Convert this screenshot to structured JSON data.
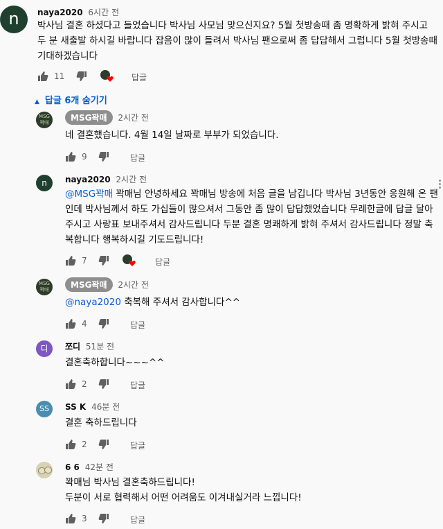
{
  "colors": {
    "link": "#065fd4",
    "meta": "#606060",
    "badge": "#8e8e8e",
    "heart": "#ff0000"
  },
  "icons": [
    "thumb-up-icon",
    "thumb-down-icon",
    "creator-heart-icon",
    "caret-up-icon",
    "more-vert-icon"
  ],
  "reply_label": "답글",
  "hide_replies": "답글 6개 숨기기",
  "comments": [
    {
      "author": "naya2020",
      "time": "6시간 전",
      "avatar": "n",
      "lines": [
        "박사님 결혼 하셨다고 들었습니다 박사님 사모님 맞으신지요?  5월 첫방송때 좀 명확하게 밝혀 주시고",
        "두 분 새출발 하시길 바랍니다 잡음이 많이 들려서 박사님 팬으로써 좀 답답해서 그럽니다 5월 첫방송때",
        "기대하겠습니다"
      ],
      "likes": "11",
      "hearted": true
    },
    {
      "author": "MSG꽉매",
      "time": "2시간 전",
      "avatar": "MSG 꽉매",
      "lines": [
        "네 결혼했습니다. 4월 14일 날짜로 부부가 되었습니다."
      ],
      "likes": "9",
      "hearted": false
    },
    {
      "author": "naya2020",
      "time": "2시간 전",
      "avatar": "n",
      "mention": "@MSG꽉매",
      "lines": [
        " 꽉매님 안녕하세요 꽉매님 방송에 처음 글을 남깁니다 박사님 3년동안 응원해 온 팬",
        "인데 박사님께서 하도 가십들이 많으셔서 그동안 좀 많이 답답했었습니다 무례한글에 답글 달아",
        "주시고 사랑표 보내주셔서 감사드립니다 두분 결혼 명쾌하게 밝혀 주셔서 감사드립니다 정말 축",
        "복합니다 행복하시길 기도드립니다!"
      ],
      "likes": "7",
      "hearted": true
    },
    {
      "author": "MSG꽉매",
      "time": "2시간 전",
      "avatar": "MSG 꽉매",
      "mention": "@naya2020",
      "lines": [
        " 축복해 주셔서 감사합니다^^"
      ],
      "likes": "4",
      "hearted": false
    },
    {
      "author": "쪼디",
      "time": "51분 전",
      "avatar": "디",
      "lines": [
        "결혼축하합니다~~~^^"
      ],
      "likes": "2",
      "hearted": false
    },
    {
      "author": "SS K",
      "time": "46분 전",
      "avatar": "SS",
      "lines": [
        "결혼 축하드립니다"
      ],
      "likes": "2",
      "hearted": false
    },
    {
      "author": "6 6",
      "time": "42분 전",
      "avatar": "",
      "lines": [
        "꽉매님 박사님 결혼축하드립니다!",
        "두분이 서로 협력해서 어떤 어려움도 이겨내실거라 느낍니다!"
      ],
      "likes": "3",
      "hearted": false
    }
  ]
}
